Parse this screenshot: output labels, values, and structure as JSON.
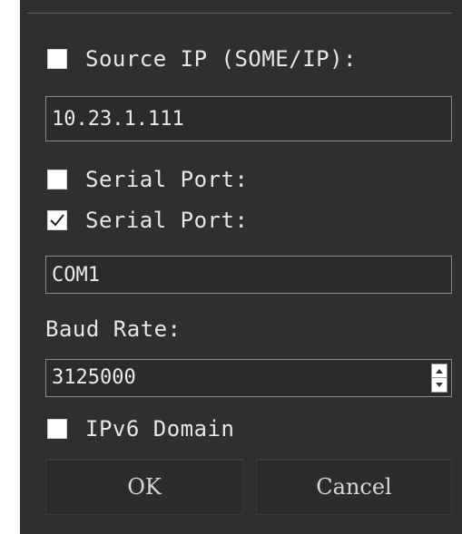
{
  "dialog": {
    "source_ip": {
      "label": "Source IP (SOME/IP):",
      "checked": false,
      "value": "10.23.1.111"
    },
    "serial_port_1": {
      "label": "Serial Port:",
      "checked": false
    },
    "serial_port_2": {
      "label": "Serial Port:",
      "checked": true,
      "value": "COM1"
    },
    "baud_rate": {
      "label": "Baud Rate:",
      "value": "3125000"
    },
    "ipv6_domain": {
      "label": "IPv6 Domain",
      "checked": false
    },
    "buttons": {
      "ok": "OK",
      "cancel": "Cancel"
    }
  },
  "icons": {
    "check": "check-icon",
    "spin_up": "arrow-up-icon",
    "spin_down": "arrow-down-icon"
  },
  "colors": {
    "background": "#2f2f2f",
    "text": "#e6e6e6",
    "field_border": "#8a8a8a",
    "checkbox": "#ffffff"
  }
}
